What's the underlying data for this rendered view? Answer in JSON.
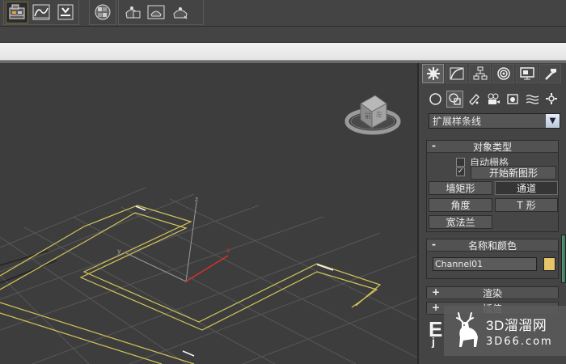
{
  "toolbar": {
    "buttons": [
      {
        "icon": "scene-explorer-icon"
      },
      {
        "icon": "curve-editor-icon"
      },
      {
        "icon": "schematic-icon"
      },
      {
        "icon": "material-editor-icon"
      },
      {
        "icon": "render-setup-icon"
      },
      {
        "icon": "rendered-frame-icon"
      },
      {
        "icon": "render-icon"
      }
    ]
  },
  "panel": {
    "tabs": [
      "create-tab-icon",
      "modify-tab-icon",
      "hierarchy-tab-icon",
      "motion-tab-icon",
      "display-tab-icon",
      "utilities-tab-icon"
    ],
    "categories": [
      "geometry-icon",
      "shapes-icon",
      "lights-icon",
      "cameras-icon",
      "helpers-icon",
      "space-warps-icon",
      "systems-icon"
    ],
    "dropdown_value": "扩展样条线",
    "object_type": {
      "title": "对象类型",
      "autogrid_label": "自动栅格",
      "start_new_shape_label": "开始新图形",
      "start_new_shape_checked": true,
      "buttons": [
        "墙矩形",
        "通道",
        "角度",
        "T 形",
        "宽法兰"
      ],
      "pressed": "通道"
    },
    "name_color": {
      "title": "名称和颜色",
      "name_value": "Channel01",
      "color": "#e6c46a"
    },
    "render": {
      "title": "渲染"
    },
    "interpolation": {
      "title": "插值"
    }
  },
  "viewport": {
    "axis_x": "x",
    "axis_y": "y",
    "axis_z": "z"
  },
  "watermark": {
    "cn": "3D溜溜网",
    "en": "3D66.com",
    "fragment1": "E",
    "fragment2": "j"
  }
}
